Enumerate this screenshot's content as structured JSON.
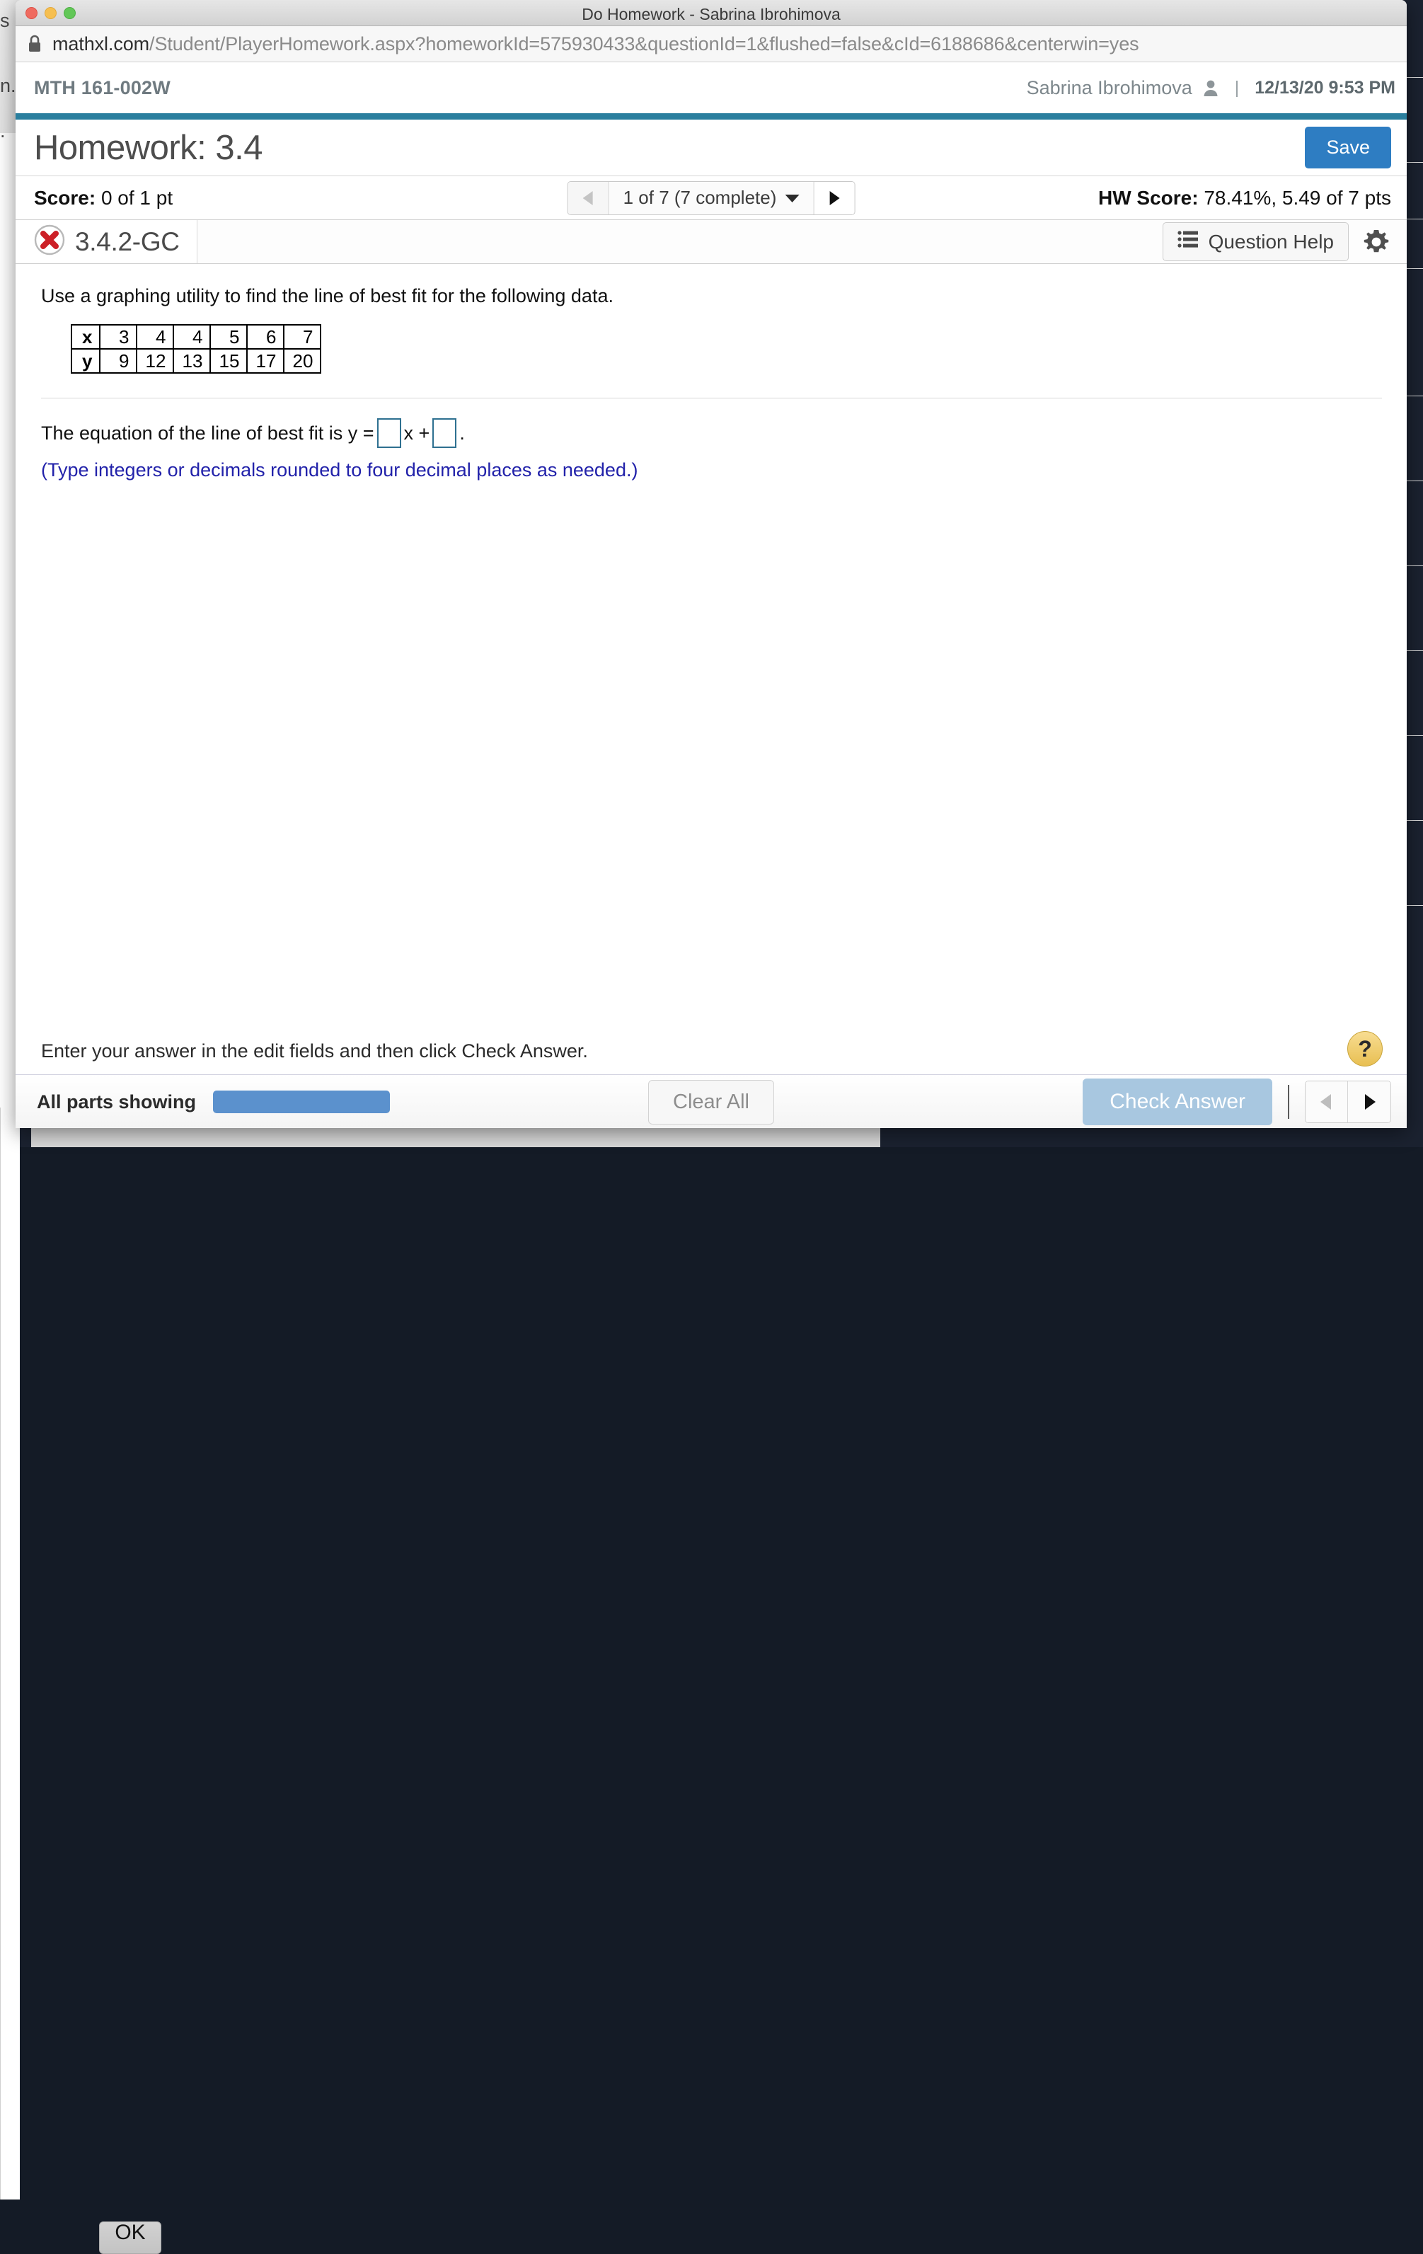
{
  "window": {
    "title": "Do Homework - Sabrina Ibrohimova",
    "url_host": "mathxl.com",
    "url_path": "/Student/PlayerHomework.aspx?homeworkId=575930433&questionId=1&flushed=false&cId=6188686&centerwin=yes"
  },
  "header": {
    "course_code": "MTH 161-002W",
    "user_name": "Sabrina Ibrohimova",
    "separator": "|",
    "timestamp": "12/13/20 9:53 PM"
  },
  "homework": {
    "title": "Homework: 3.4",
    "save_label": "Save",
    "score_label": "Score:",
    "score_value": "0 of 1 pt",
    "question_counter": "1 of 7 (7 complete)",
    "hw_score_label": "HW Score:",
    "hw_score_value": "78.41%, 5.49 of 7 pts"
  },
  "question": {
    "id": "3.4.2-GC",
    "status_icon": "incorrect-x-icon",
    "help_label": "Question Help",
    "prompt": "Use a graphing utility to find the line of best fit for the following data.",
    "answer_prefix": "The equation of the line of best fit is y =",
    "answer_middle": "x +",
    "answer_suffix": ".",
    "answer_hint": "(Type integers or decimals rounded to four decimal places as needed.)",
    "answer_box_1_value": "",
    "answer_box_2_value": ""
  },
  "chart_data": {
    "type": "table",
    "title": "",
    "row_labels": [
      "x",
      "y"
    ],
    "x": [
      3,
      4,
      4,
      5,
      6,
      7
    ],
    "y": [
      9,
      12,
      13,
      15,
      17,
      20
    ],
    "rows": [
      {
        "label": "x",
        "values": [
          3,
          4,
          4,
          5,
          6,
          7
        ]
      },
      {
        "label": "y",
        "values": [
          9,
          12,
          13,
          15,
          17,
          20
        ]
      }
    ],
    "xlabel": "x",
    "ylabel": "y"
  },
  "footer": {
    "instruction": "Enter your answer in the edit fields and then click Check Answer.",
    "help_bubble": "?",
    "parts_status": "All parts showing",
    "clear_all_label": "Clear All",
    "check_answer_label": "Check Answer"
  },
  "background": {
    "left_fragment_1": "s",
    "left_fragment_2": "n.",
    "left_fragment_3": ".",
    "ok_label": "OK"
  },
  "colors": {
    "accent_teal": "#2a7f9e",
    "save_blue": "#2e7dc2",
    "check_answer_blue": "#a8c7e0",
    "answer_box_border": "#2e7090",
    "hint_blue": "#2222aa",
    "incorrect_red": "#cc2027",
    "progress_blue": "#5b91cd"
  }
}
